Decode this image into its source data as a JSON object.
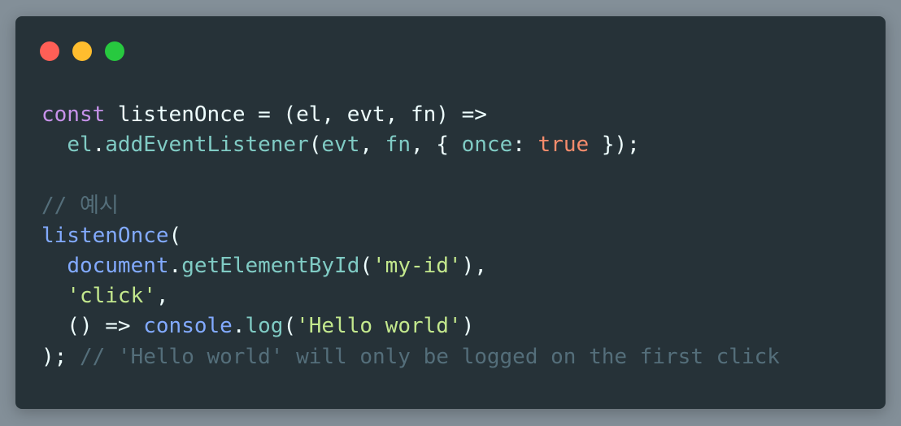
{
  "theme": {
    "page_background": "#838f98",
    "editor_background": "#263238",
    "traffic_lights": {
      "close": "#ff5f56",
      "minimize": "#ffbd2e",
      "maximize": "#27c93f"
    }
  },
  "code": {
    "lines": [
      [
        {
          "t": "keyword",
          "v": "const"
        },
        {
          "t": "plain",
          "v": " listenOnce = (el, evt, fn) =>"
        }
      ],
      [
        {
          "t": "plain",
          "v": "  "
        },
        {
          "t": "prop",
          "v": "el"
        },
        {
          "t": "plain",
          "v": "."
        },
        {
          "t": "prop",
          "v": "addEventListener"
        },
        {
          "t": "plain",
          "v": "("
        },
        {
          "t": "prop",
          "v": "evt"
        },
        {
          "t": "plain",
          "v": ", "
        },
        {
          "t": "prop",
          "v": "fn"
        },
        {
          "t": "plain",
          "v": ", { "
        },
        {
          "t": "prop",
          "v": "once"
        },
        {
          "t": "plain",
          "v": ": "
        },
        {
          "t": "bool",
          "v": "true"
        },
        {
          "t": "plain",
          "v": " });"
        }
      ],
      [],
      [
        {
          "t": "comment",
          "v": "// 예시"
        }
      ],
      [
        {
          "t": "func",
          "v": "listenOnce"
        },
        {
          "t": "plain",
          "v": "("
        }
      ],
      [
        {
          "t": "plain",
          "v": "  "
        },
        {
          "t": "func",
          "v": "document"
        },
        {
          "t": "plain",
          "v": "."
        },
        {
          "t": "prop",
          "v": "getElementById"
        },
        {
          "t": "plain",
          "v": "("
        },
        {
          "t": "string",
          "v": "'my-id'"
        },
        {
          "t": "plain",
          "v": "),"
        }
      ],
      [
        {
          "t": "plain",
          "v": "  "
        },
        {
          "t": "string",
          "v": "'click'"
        },
        {
          "t": "plain",
          "v": ","
        }
      ],
      [
        {
          "t": "plain",
          "v": "  () => "
        },
        {
          "t": "func",
          "v": "console"
        },
        {
          "t": "plain",
          "v": "."
        },
        {
          "t": "prop",
          "v": "log"
        },
        {
          "t": "plain",
          "v": "("
        },
        {
          "t": "string",
          "v": "'Hello world'"
        },
        {
          "t": "plain",
          "v": ")"
        }
      ],
      [
        {
          "t": "plain",
          "v": "); "
        },
        {
          "t": "comment",
          "v": "// 'Hello world' will only be logged on the first click"
        }
      ]
    ]
  }
}
